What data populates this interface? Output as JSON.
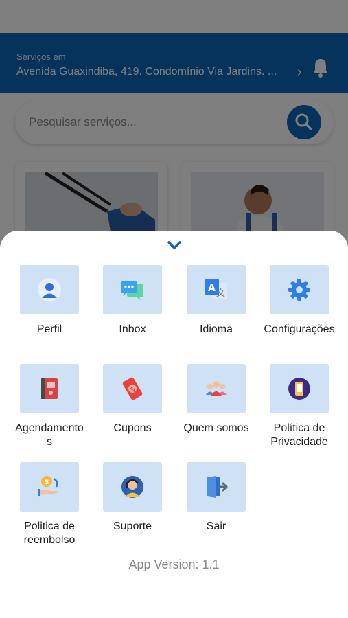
{
  "header": {
    "services_label": "Serviços em",
    "address": "Avenida Guaxindiba, 419. Condomínio Via Jardins. ...",
    "chevron": "›"
  },
  "search": {
    "placeholder": "Pesquisar serviços..."
  },
  "menu": {
    "items": [
      {
        "label": "Perfil",
        "icon": "person-icon"
      },
      {
        "label": "Inbox",
        "icon": "chat-bubbles-icon"
      },
      {
        "label": "Idioma",
        "icon": "translate-icon"
      },
      {
        "label": "Configurações",
        "icon": "gear-icon"
      },
      {
        "label": "Agendamento\ns",
        "icon": "calendar-book-icon"
      },
      {
        "label": "Cupons",
        "icon": "coupon-icon"
      },
      {
        "label": "Quem somos",
        "icon": "team-icon"
      },
      {
        "label": "Política de\nPrivacidade",
        "icon": "privacy-phone-icon"
      },
      {
        "label": "Politica de\nreembolso",
        "icon": "refund-hand-icon"
      },
      {
        "label": "Suporte",
        "icon": "support-agent-icon"
      },
      {
        "label": "Sair",
        "icon": "logout-door-icon"
      }
    ]
  },
  "footer": {
    "version": "App Version: 1.1"
  },
  "colors": {
    "primary": "#0a67b8",
    "tile": "#cfe2f5"
  }
}
